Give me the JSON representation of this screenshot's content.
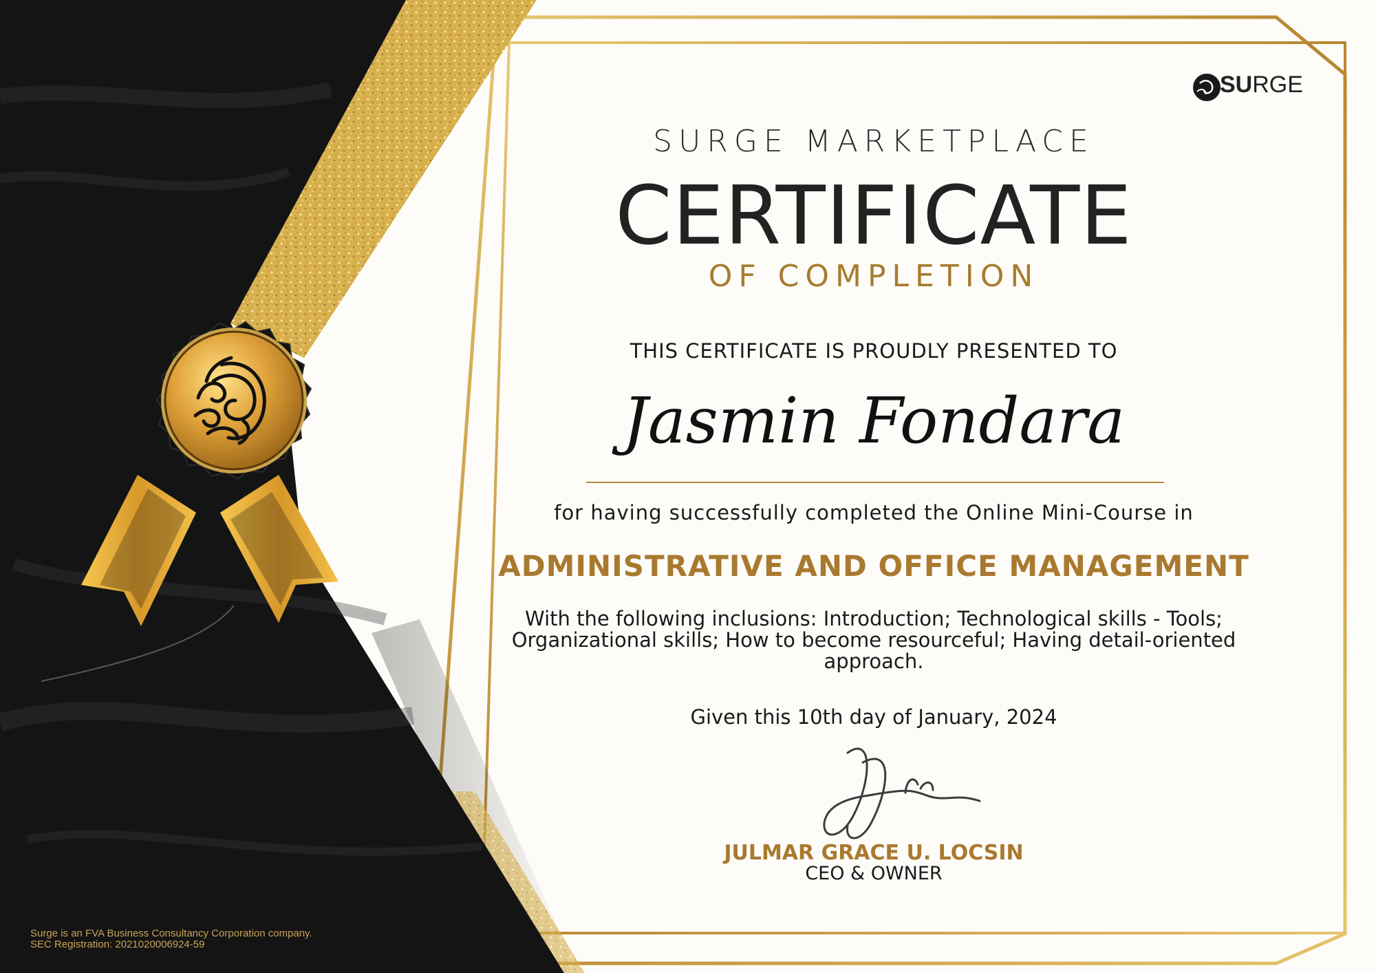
{
  "brand": {
    "logo_bold": "SU",
    "logo_light": "RGE"
  },
  "certificate": {
    "organization": "SURGE MARKETPLACE",
    "title": "CERTIFICATE",
    "subtitle": "OF COMPLETION",
    "presented_text": "THIS CERTIFICATE IS PROUDLY PRESENTED TO",
    "recipient": "Jasmin Fondara",
    "completion_text": "for having successfully completed the Online Mini-Course in",
    "course": "ADMINISTRATIVE AND OFFICE MANAGEMENT",
    "inclusions": "With the following inclusions: Introduction; Technological skills - Tools; Organizational skills; How to become resourceful; Having detail-oriented approach.",
    "given": "Given this 10th  day of January, 2024",
    "signer_name": "JULMAR GRACE U. LOCSIN",
    "signer_title": "CEO & OWNER"
  },
  "footer": {
    "line1": "Surge is an FVA Business Consultancy Corporation company.",
    "line2": "SEC Registration: 2021020006924-59"
  },
  "colors": {
    "gold": "#a9792f",
    "black": "#141414",
    "paper": "#fdfcf8"
  },
  "icons": {
    "seal": "wave-seal-icon",
    "logo": "surge-logo-icon"
  }
}
